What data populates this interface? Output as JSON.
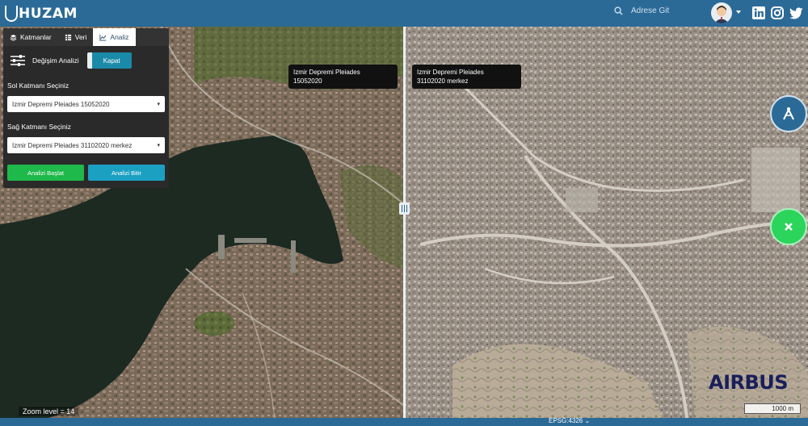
{
  "header": {
    "logo_text": "HUZAM",
    "search_placeholder": "Adrese Git",
    "social": [
      "linkedin-icon",
      "instagram-icon",
      "twitter-icon"
    ]
  },
  "panel": {
    "tabs": [
      {
        "label": "Katmanlar",
        "icon": "layers-icon",
        "active": false
      },
      {
        "label": "Veri",
        "icon": "database-icon",
        "active": false
      },
      {
        "label": "Analiz",
        "icon": "chart-icon",
        "active": true
      }
    ],
    "change_analysis_label": "Değişim Analizi",
    "close_label": "Kapat",
    "left_layer_label": "Sol Katmanı Seçiniz",
    "left_layer_value": "Izmir Depremi Pleiades 15052020",
    "right_layer_label": "Sağ Katmanı Seçiniz",
    "right_layer_value": "Izmir Depremi Pleiades 31102020 merkez",
    "start_button": "Analizi Başlat",
    "end_button": "Analizi Bitir"
  },
  "map": {
    "left_image_label_line1": "Izmir Depremi Pleiades",
    "left_image_label_line2": "15052020",
    "right_image_label_line1": "Izmir Depremi Pleiades",
    "right_image_label_line2": "31102020 merkez",
    "brand": "AIRBUS",
    "scale_label": "1000 m",
    "zoom_text": "Zoom level = 14",
    "projection": "EPSG:4326"
  },
  "colors": {
    "topbar": "#2b6a96",
    "start_button": "#1fb84a",
    "end_button": "#1ba0c2",
    "fab_a": "#2b6a96",
    "fab_x": "#2bd45a"
  }
}
